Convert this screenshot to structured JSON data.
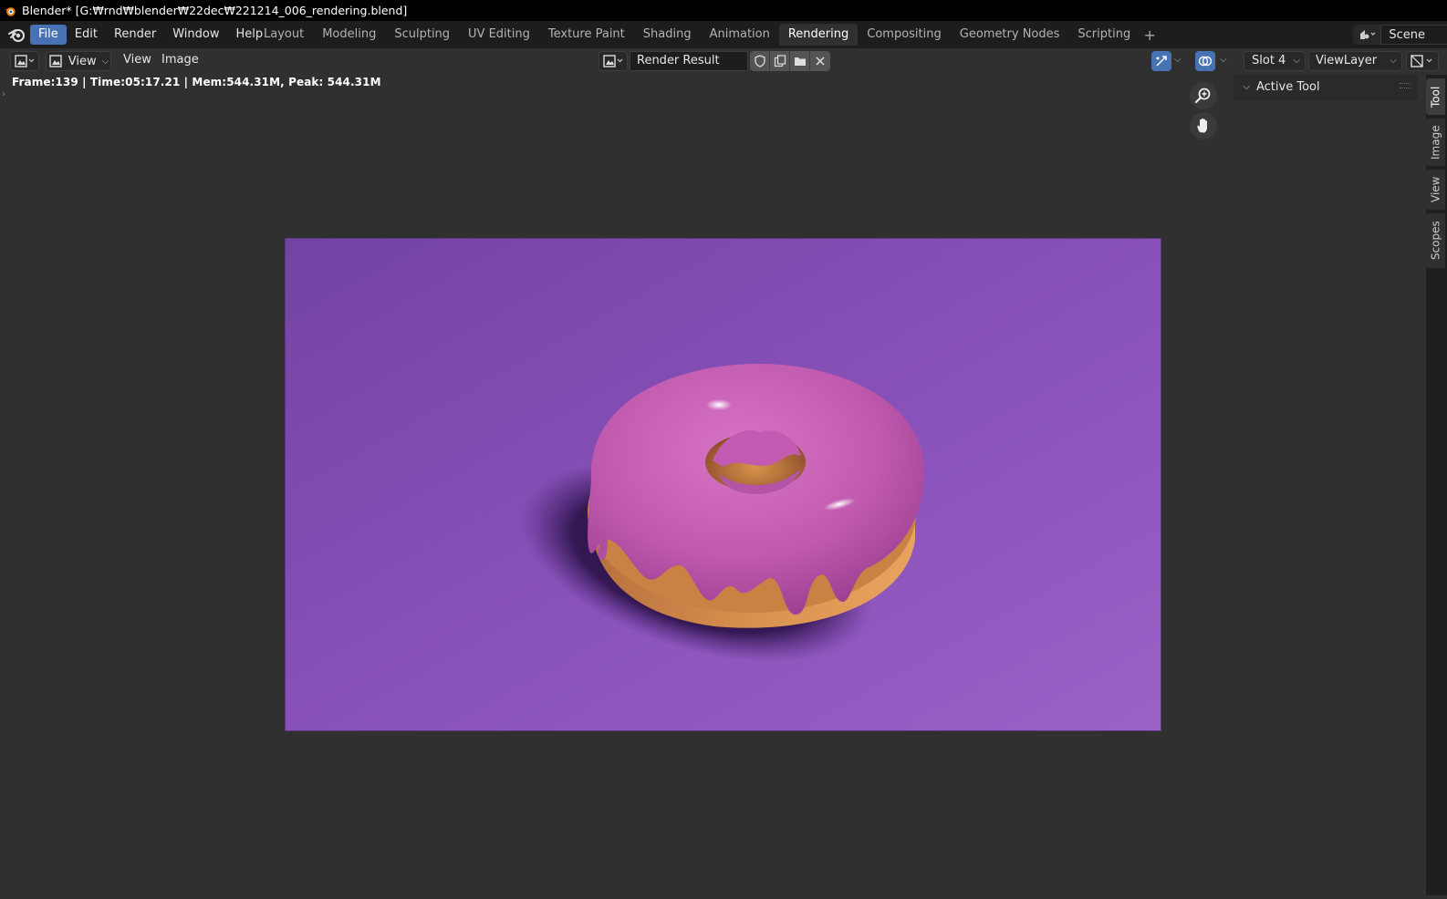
{
  "window": {
    "title": "Blender* [G:₩rnd₩blender₩22dec₩221214_006_rendering.blend]"
  },
  "menu": {
    "items": [
      "File",
      "Edit",
      "Render",
      "Window",
      "Help"
    ]
  },
  "workspaces": {
    "tabs": [
      "Layout",
      "Modeling",
      "Sculpting",
      "UV Editing",
      "Texture Paint",
      "Shading",
      "Animation",
      "Rendering",
      "Compositing",
      "Geometry Nodes",
      "Scripting"
    ],
    "active": "Rendering",
    "add_label": "+"
  },
  "scene": {
    "name": "Scene"
  },
  "editor_header": {
    "view_dropdown": "View",
    "view_menu": "View",
    "image_menu": "Image",
    "image_name": "Render Result",
    "slot": "Slot 4",
    "view_layer": "ViewLayer"
  },
  "render_info": "Frame:139 | Time:05:17.21 | Mem:544.31M, Peak: 544.31M",
  "sidebar": {
    "panel_title": "Active Tool",
    "tabs": [
      "Tool",
      "Image",
      "View",
      "Scopes"
    ],
    "active_tab": "Tool"
  },
  "colors": {
    "accent": "#4772b3",
    "background_purple": "#8a52b8",
    "icing_pink": "#c45bb3",
    "dough": "#d98f4a"
  }
}
